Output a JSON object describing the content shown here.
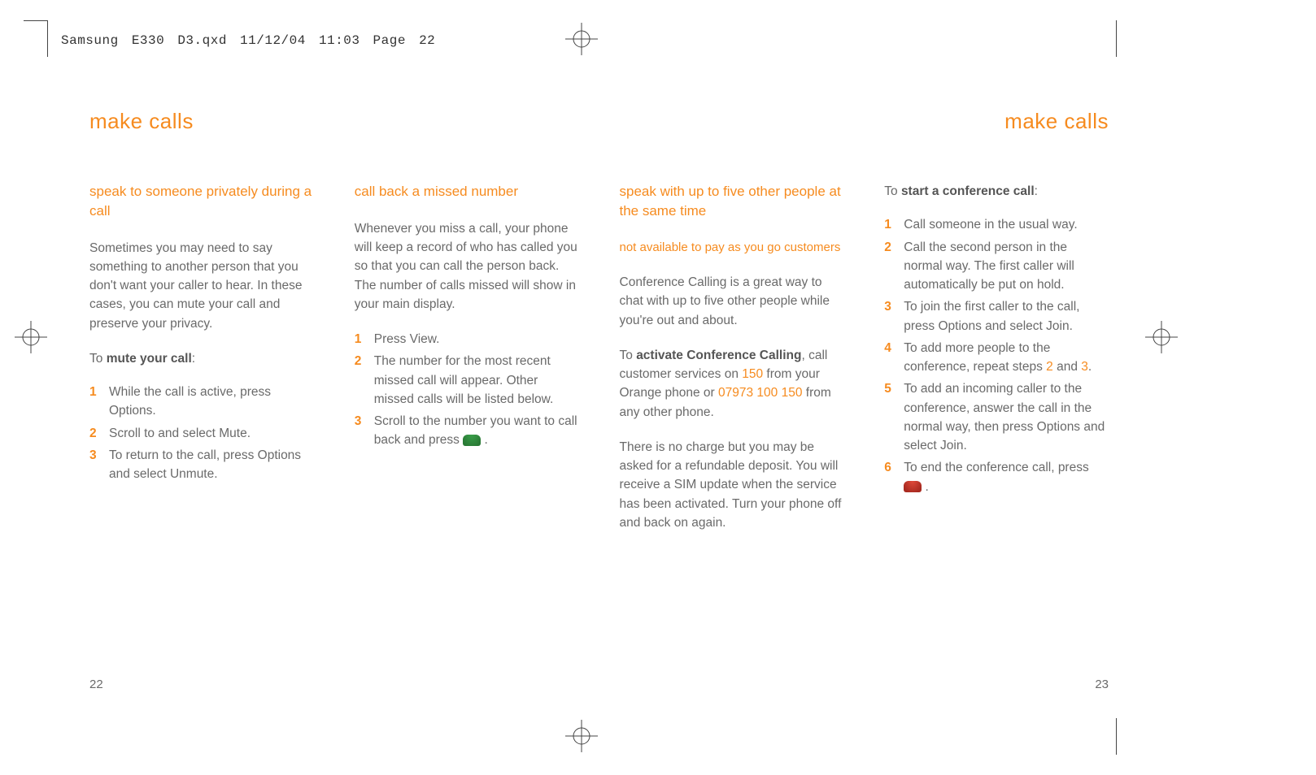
{
  "slug": "Samsung E330 D3.qxd  11/12/04  11:03  Page 22",
  "left": {
    "running_head": "make calls",
    "folio": "22",
    "col1": {
      "subhead": "speak to someone privately during a call",
      "para1": "Sometimes you may need to say something to another person that you don't want your caller to hear. In these cases, you can mute your call and preserve your privacy.",
      "lead_pre": "To ",
      "lead_bold": "mute your call",
      "lead_post": ":",
      "steps": [
        {
          "n": "1",
          "t": "While the call is active, press Options."
        },
        {
          "n": "2",
          "t": "Scroll to and select Mute."
        },
        {
          "n": "3",
          "t": "To return to the call, press Options and select Unmute."
        }
      ]
    },
    "col2": {
      "subhead": "call back a missed number",
      "para1": "Whenever you miss a call, your phone will keep a record of who has called you so that you can call the person back.",
      "para2": "The number of calls missed will show in your main display.",
      "steps": [
        {
          "n": "1",
          "t": "Press View."
        },
        {
          "n": "2",
          "t": "The number for the most recent missed call will appear. Other missed calls will be listed below."
        },
        {
          "n": "3",
          "t_pre": "Scroll to the number you want to call back and press  ",
          "t_post": " ."
        }
      ]
    }
  },
  "right": {
    "running_head": "make calls",
    "folio": "23",
    "col1": {
      "subhead": "speak with up to five other people at the same time",
      "note": "not available to pay as you go customers",
      "para1": "Conference Calling is a great way to chat with up to five other people while you're out and about.",
      "para2_pre": "To ",
      "para2_bold": "activate Conference Calling",
      "para2_mid": ", call customer services on ",
      "para2_num1": "150",
      "para2_mid2": " from your Orange phone or ",
      "para2_num2": "07973 100 150",
      "para2_post": " from any other phone.",
      "para3": "There is no charge but you may be asked for a refundable deposit. You will receive a SIM update when the service has been activated. Turn your phone off and back on again."
    },
    "col2": {
      "lead_pre": "To ",
      "lead_bold": "start a conference call",
      "lead_post": ":",
      "steps": [
        {
          "n": "1",
          "t": "Call someone in the usual way."
        },
        {
          "n": "2",
          "t": "Call the second person in the normal way. The first caller will automatically be put on hold."
        },
        {
          "n": "3",
          "t": "To join the first caller to the call, press Options and select Join."
        },
        {
          "n": "4",
          "t_pre": "To add more people to the conference, repeat steps ",
          "o1": "2",
          "mid": " and ",
          "o2": "3",
          "post": "."
        },
        {
          "n": "5",
          "t": "To add an incoming caller to the conference, answer the call in the normal way, then press Options and select Join."
        },
        {
          "n": "6",
          "t_pre": "To end the conference call, press  ",
          "t_post": " ."
        }
      ]
    }
  }
}
